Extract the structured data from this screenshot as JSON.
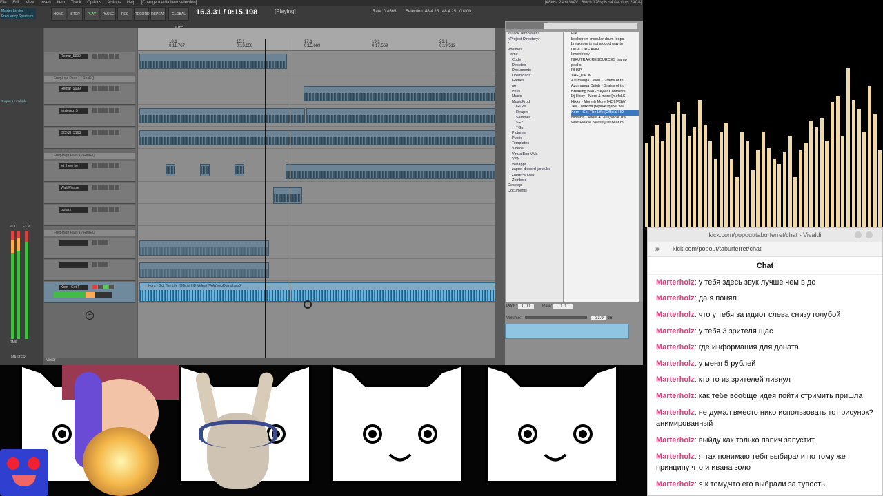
{
  "daw": {
    "menu": [
      "File",
      "Edit",
      "View",
      "Insert",
      "Item",
      "Track",
      "Options",
      "Actions",
      "Help",
      "[Change media item selection]"
    ],
    "transport_buttons": [
      "HOME",
      "STOP",
      "PLAY",
      "PAUSE",
      "REC",
      "RECORD",
      "REPEAT",
      "GLOBAL AUTO"
    ],
    "time": "16.3.31 / 0:15.198",
    "state": "[Playing]",
    "rate_label": "Rate: 0.8565",
    "selection_label": "Selection:",
    "selection_start": "48.4.25",
    "selection_end": "48.4.25",
    "selection_len": "0.0.00",
    "format_info": "[48kHz 24bit WAV : 8/8ch 128spls ~4.0/4.0ms 2ACA]",
    "ruler_marks": [
      {
        "bar": "13.1",
        "time": "0:11.767"
      },
      {
        "bar": "15.1",
        "time": "0:13.658"
      },
      {
        "bar": "17.1",
        "time": "0:15.669"
      },
      {
        "bar": "19.1",
        "time": "0:17.569"
      },
      {
        "bar": "21.1",
        "time": "0:19.512"
      }
    ],
    "left_panel": {
      "title_a": "Master Limiter",
      "title_b": "Frequency Spectrum",
      "multiple": "Output 1 : multiple",
      "master_label": "MASTER",
      "rms": "RMS",
      "val_a": "-0.1",
      "val_b": "-3.9"
    },
    "tracks": [
      {
        "name": "Remar_9999",
        "num": "1"
      },
      {
        "fx": "Freq-Low Pass 1 / ReaEQ"
      },
      {
        "name": "Remar_9999",
        "num": "2"
      },
      {
        "name": "Mistereo_5",
        "num": "3"
      },
      {
        "name": "DCNZI_3168",
        "num": "4"
      },
      {
        "fx": "Freq-High Pass 1 / ReaEQ"
      },
      {
        "name": "let there be",
        "num": "5"
      },
      {
        "name": "Walt Please",
        "num": "6"
      },
      {
        "name": "guitars",
        "num": "7"
      },
      {
        "fx": "Freq-High Pass 1 / ReaEQ"
      },
      {
        "name": "",
        "num": "8"
      },
      {
        "name": "",
        "num": "9"
      },
      {
        "name": "Korn - Got T",
        "num": "10"
      }
    ],
    "items": {
      "korm": "Korn - Got The Life (Official HD Video) [VAWjvVoDgmo].mp3"
    },
    "mixer_status": "Mixer",
    "browser": {
      "tree": [
        "<Track Templates>",
        "<Project Directory>",
        "/",
        "Volumes",
        "Home",
        "Code",
        "Desktop",
        "Documents",
        "Downloads",
        "Games",
        "go",
        "ISOs",
        "Music",
        "MusicProd",
        "GTPs",
        "Reaper",
        "Samples",
        "SF2",
        "TGs",
        "Pictures",
        "Public",
        "Templates",
        "Videos",
        "VirtualBox VMs",
        "VPN",
        "Winapps",
        "zapret-discord-youtube",
        "zapret-snowy",
        "Zomboid",
        "Desktop",
        "Documents"
      ],
      "files": [
        "File",
        "beckstrom-modular-drum-loops-",
        "breakcore is not a good way to",
        "DIGICORE AHH",
        "lowentropy",
        "NIKUTRAX RESOURCES [samp",
        "peaks",
        "RHSP",
        "THE_PACK",
        "Azumanga Daioh - Grains of tru",
        "Azumanga Daioh - Grains of tru",
        "Breaking Bad - Skyler Confronts",
        "Dj Hixxy - More & more [mefsLS",
        "Hixxy - More & More [HQ] [PSW",
        "Jea - Makiba [Myin4l0qJBs].wel",
        "Korn - Got The Life (Official HD",
        "Nirvana - About A Girl (Vocal Tra",
        "Walt Please please just hear m"
      ],
      "selected_file": "Korn - Got The Life (Official HD",
      "pitch_label": "Pitch:",
      "pitch": "0.00",
      "rate_label": "Rate:",
      "rate": "1.0",
      "volume_label": "Volume:",
      "volume": "-33.9",
      "db": "dB"
    }
  },
  "visualizer": {
    "bars": [
      0.37,
      0.4,
      0.45,
      0.38,
      0.46,
      0.5,
      0.55,
      0.5,
      0.4,
      0.44,
      0.56,
      0.45,
      0.38,
      0.3,
      0.42,
      0.46,
      0.3,
      0.22,
      0.42,
      0.38,
      0.25,
      0.34,
      0.42,
      0.35,
      0.3,
      0.28,
      0.33,
      0.4,
      0.22,
      0.34,
      0.37,
      0.47,
      0.44,
      0.48,
      0.38,
      0.55,
      0.58,
      0.4,
      0.7,
      0.56,
      0.52,
      0.42,
      0.62,
      0.5,
      0.34
    ]
  },
  "browser_window": {
    "title": "kick.com/popout/taburferret/chat - Vivaldi",
    "url": "kick.com/popout/taburferret/chat",
    "chat_header": "Chat",
    "messages": [
      {
        "user": "Marterholz",
        "text": ": у тебя здесь звук лучше чем в дс"
      },
      {
        "user": "Marterholz",
        "text": ": да я понял"
      },
      {
        "user": "Marterholz",
        "text": ": что у тебя за идиот слева снизу голубой"
      },
      {
        "user": "Marterholz",
        "text": ": у тебя 3 зрителя щас"
      },
      {
        "user": "Marterholz",
        "text": ": где информация для доната"
      },
      {
        "user": "Marterholz",
        "text": ": у меня 5 рублей"
      },
      {
        "user": "Marterholz",
        "text": ": кто то из зрителей ливнул"
      },
      {
        "user": "Marterholz",
        "text": ": как тебе вообще идея пойти стримить пришла"
      },
      {
        "user": "Marterholz",
        "text": ": не думал вместо нико использовать тот рисунок? анимированный"
      },
      {
        "user": "Marterholz",
        "text": ": выйду как только папич запустит"
      },
      {
        "user": "Marterholz",
        "text": ": я так понимаю тебя выбирали по тому же принципу что и ивана золо"
      },
      {
        "user": "Marterholz",
        "text": ": я к тому,что его выбрали за тупость"
      }
    ]
  },
  "colors": {
    "username": "#d6447e",
    "accent": "#3a78c4",
    "vizbar": "#f1d9a5"
  }
}
